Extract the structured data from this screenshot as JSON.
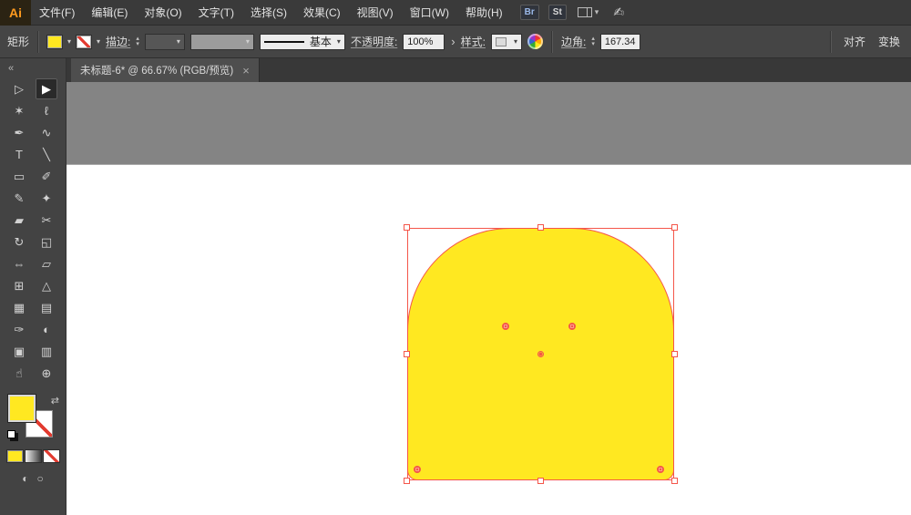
{
  "app": {
    "logo_text": "Ai"
  },
  "menu": {
    "items": [
      {
        "name": "menu-item-file",
        "label": "文件(F)"
      },
      {
        "name": "menu-item-edit",
        "label": "编辑(E)"
      },
      {
        "name": "menu-item-object",
        "label": "对象(O)"
      },
      {
        "name": "menu-item-type",
        "label": "文字(T)"
      },
      {
        "name": "menu-item-select",
        "label": "选择(S)"
      },
      {
        "name": "menu-item-effect",
        "label": "效果(C)"
      },
      {
        "name": "menu-item-view",
        "label": "视图(V)"
      },
      {
        "name": "menu-item-window",
        "label": "窗口(W)"
      },
      {
        "name": "menu-item-help",
        "label": "帮助(H)"
      }
    ],
    "bridge_badge": "Br",
    "stock_badge": "St"
  },
  "control_bar": {
    "tool_name": "矩形",
    "stroke_label": "描边:",
    "brush_definition": "基本",
    "opacity_label": "不透明度:",
    "opacity_value": "100%",
    "style_label": "样式:",
    "corner_label": "边角:",
    "corner_value": "167.34",
    "align_label": "对齐",
    "transform_label": "变换"
  },
  "document_tab": {
    "title": "未标题-6* @ 66.67% (RGB/预览)"
  },
  "toolbar": {
    "tools": [
      {
        "name": "direct-selection-tool",
        "glyph": "▷"
      },
      {
        "name": "selection-tool",
        "glyph": "▶",
        "cls": "active"
      },
      {
        "name": "magic-wand-tool",
        "glyph": "✶"
      },
      {
        "name": "lasso-tool",
        "glyph": "ℓ"
      },
      {
        "name": "pen-tool",
        "glyph": "✒"
      },
      {
        "name": "curvature-tool",
        "glyph": "∿"
      },
      {
        "name": "type-tool",
        "glyph": "T"
      },
      {
        "name": "line-segment-tool",
        "glyph": "╲"
      },
      {
        "name": "rectangle-tool",
        "glyph": "▭"
      },
      {
        "name": "paintbrush-tool",
        "glyph": "✐"
      },
      {
        "name": "pencil-tool",
        "glyph": "✎"
      },
      {
        "name": "shaper-tool",
        "glyph": "✦"
      },
      {
        "name": "eraser-tool",
        "glyph": "▰"
      },
      {
        "name": "scissors-tool",
        "glyph": "✂"
      },
      {
        "name": "rotate-tool",
        "glyph": "↻"
      },
      {
        "name": "scale-tool",
        "glyph": "◱"
      },
      {
        "name": "width-tool",
        "glyph": "⇔"
      },
      {
        "name": "free-transform-tool",
        "glyph": "▱"
      },
      {
        "name": "shape-builder-tool",
        "glyph": "⊞"
      },
      {
        "name": "perspective-grid-tool",
        "glyph": "△"
      },
      {
        "name": "mesh-tool",
        "glyph": "▦"
      },
      {
        "name": "gradient-tool",
        "glyph": "▤"
      },
      {
        "name": "eyedropper-tool",
        "glyph": "✑"
      },
      {
        "name": "blend-tool",
        "glyph": "◐"
      },
      {
        "name": "artboard-tool",
        "glyph": "▣"
      },
      {
        "name": "graph-tool",
        "glyph": "▥"
      },
      {
        "name": "hand-tool",
        "glyph": "☝"
      },
      {
        "name": "zoom-tool",
        "glyph": "⊕"
      }
    ]
  },
  "icons": {
    "collapse": "«",
    "close": "×",
    "caret_down": "▾",
    "caret_up": "▴",
    "chevron_right": "›",
    "swap": "⇄",
    "scribble": "✍",
    "screen_mode": "◐",
    "draw_normal": "○"
  },
  "canvas": {
    "shape_fill": "#FFE821",
    "selection_color": "#F4564A"
  }
}
